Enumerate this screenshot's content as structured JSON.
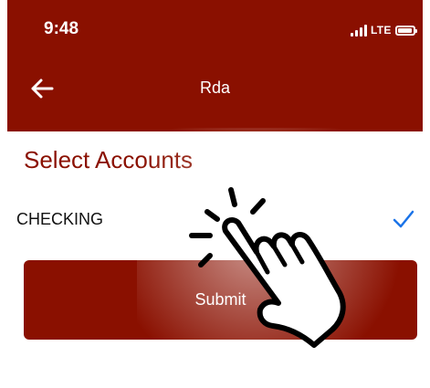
{
  "status_bar": {
    "time": "9:48",
    "network": "LTE"
  },
  "nav": {
    "title": "Rda",
    "back_icon": "back-arrow-icon"
  },
  "content": {
    "section_title": "Select Accounts",
    "accounts": [
      {
        "label": "CHECKING",
        "selected": true
      }
    ],
    "submit_label": "Submit"
  },
  "colors": {
    "brand": "#8a1000",
    "check": "#1a73e8",
    "background": "#ffffff"
  },
  "overlay": {
    "icon": "tap-hand-icon"
  }
}
